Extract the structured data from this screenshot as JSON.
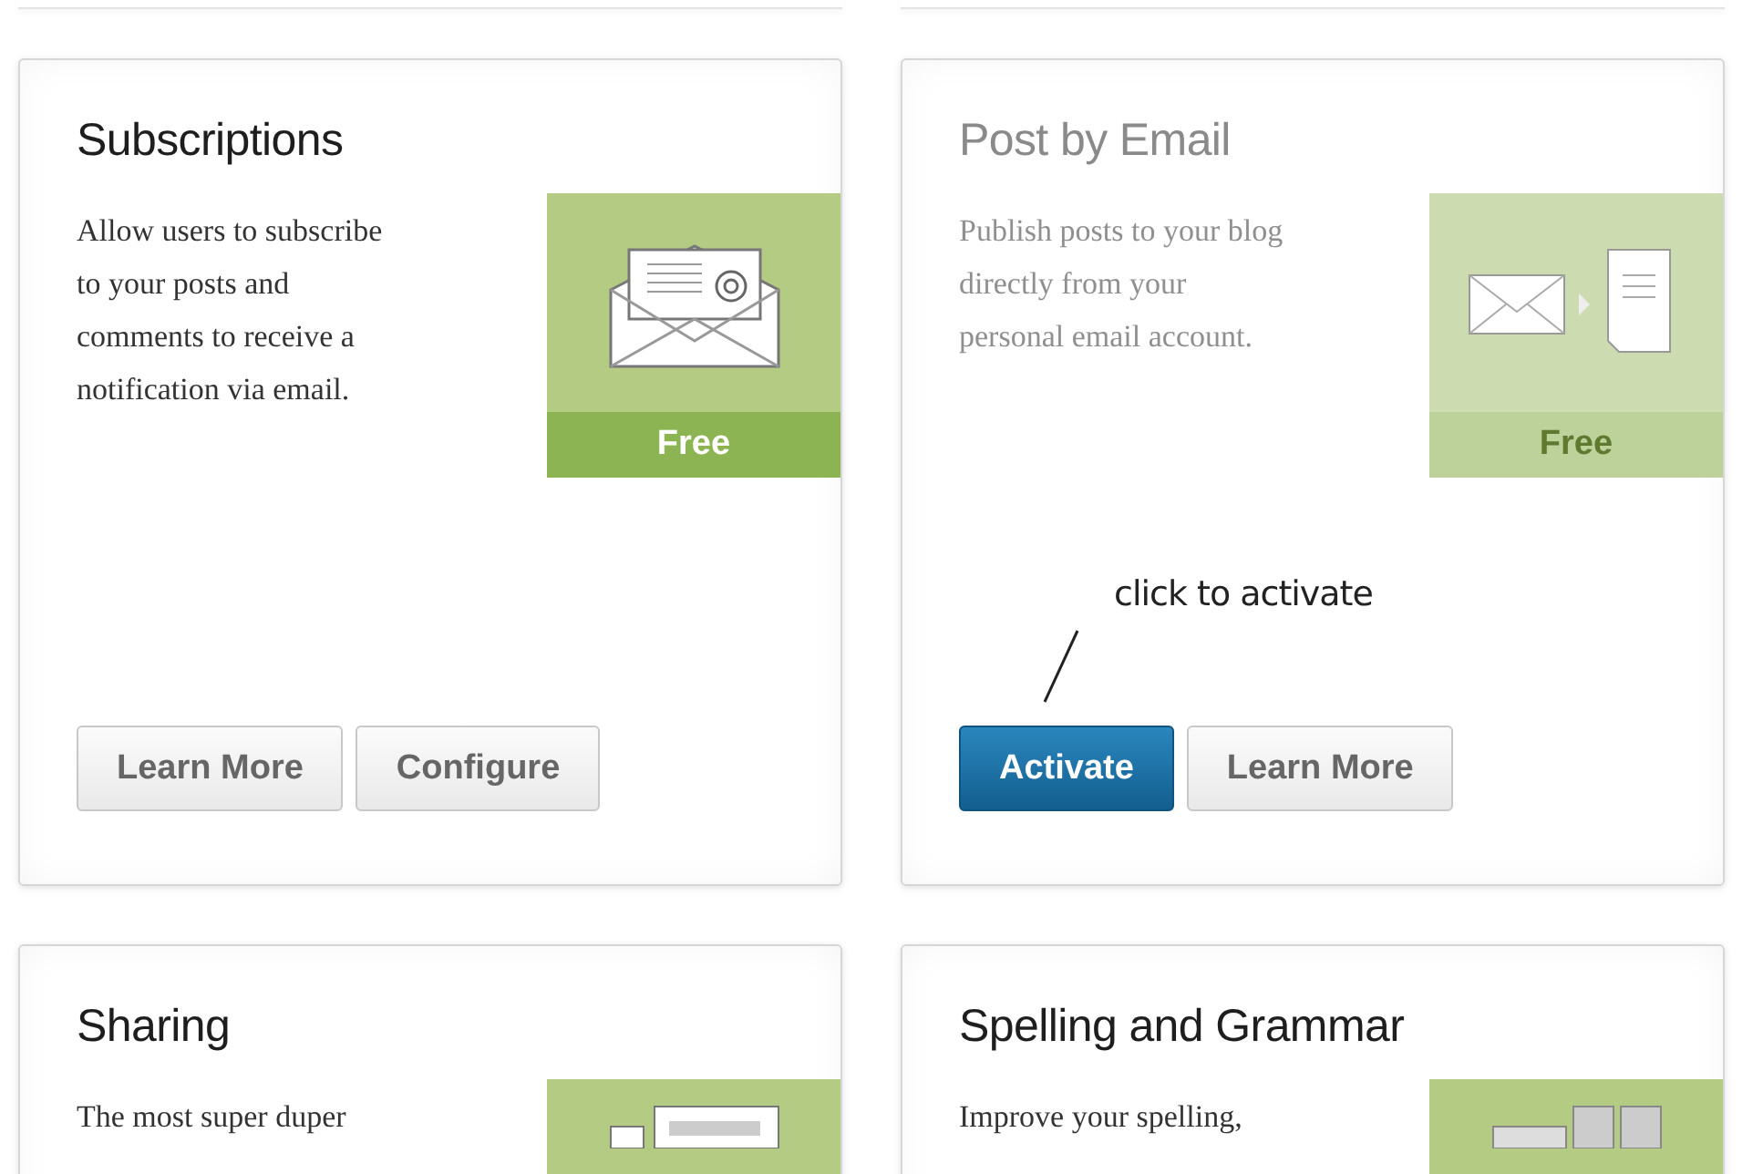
{
  "annotation": {
    "text": "click to activate"
  },
  "modules": [
    {
      "title": "Subscriptions",
      "description": "Allow users to subscribe to your posts and comments to receive a notification via email.",
      "active": true,
      "badge": "Free",
      "buttons": [
        {
          "label": "Learn More",
          "kind": "default"
        },
        {
          "label": "Configure",
          "kind": "default"
        }
      ]
    },
    {
      "title": "Post by Email",
      "description": "Publish posts to your blog directly from your personal email account.",
      "active": false,
      "badge": "Free",
      "buttons": [
        {
          "label": "Activate",
          "kind": "primary"
        },
        {
          "label": "Learn More",
          "kind": "default"
        }
      ]
    },
    {
      "title": "Sharing",
      "description": "The most super duper",
      "active": true
    },
    {
      "title": "Spelling and Grammar",
      "description": "Improve your spelling,",
      "active": true
    }
  ]
}
